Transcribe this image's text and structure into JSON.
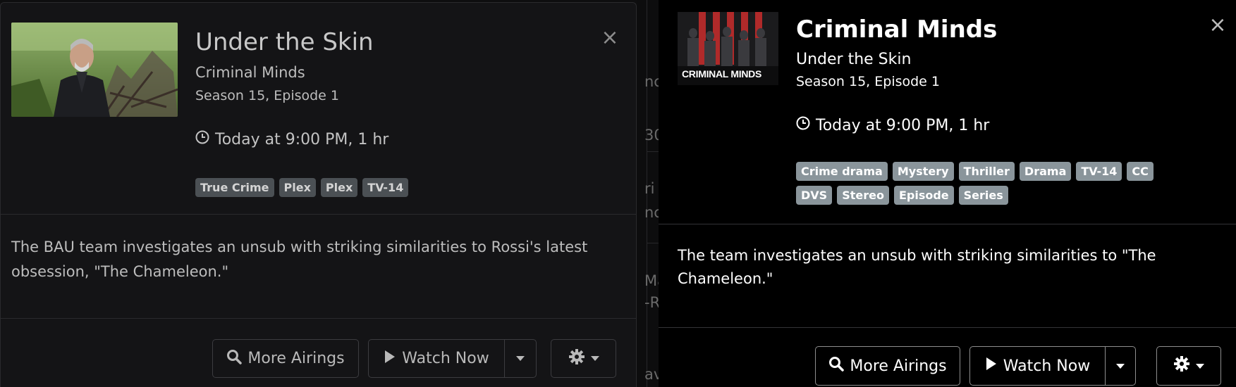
{
  "left_modal": {
    "title": "Under the Skin",
    "show": "Criminal Minds",
    "episode": "Season 15, Episode 1",
    "airtime": "Today at 9:00 PM, 1 hr",
    "badges": [
      "True Crime",
      "Plex",
      "Plex",
      "TV-14"
    ],
    "description": "The BAU team investigates an unsub with striking similarities to Rossi's latest obsession, \"The Chameleon.\"",
    "close_symbol": "×",
    "more_airings_label": "More Airings",
    "watch_now_label": "Watch Now"
  },
  "right_modal": {
    "title": "Criminal Minds",
    "episode_title": "Under the Skin",
    "episode": "Season 15, Episode 1",
    "airtime": "Today at 9:00 PM, 1 hr",
    "badges": [
      "Crime drama",
      "Mystery",
      "Thriller",
      "Drama",
      "TV-14",
      "CC",
      "DVS",
      "Stereo",
      "Episode",
      "Series"
    ],
    "description": "The team investigates an unsub with striking similarities to \"The Chameleon.\"",
    "close_symbol": "×",
    "more_airings_label": "More Airings",
    "watch_now_label": "Watch Now",
    "poster_text": "CRIMINAL MINDS"
  },
  "background_fragments": [
    "nc",
    "30",
    "ri",
    "nc",
    "Ma",
    "-R",
    "av"
  ],
  "icons": {
    "clock": "clock-icon",
    "search": "search-icon",
    "play": "play-icon",
    "gear": "gear-icon",
    "caret": "chevron-down-icon"
  },
  "colors": {
    "left_badge_bg": "#4b5054",
    "right_badge_bg": "#8a959b",
    "left_modal_bg": "#141416",
    "right_modal_bg": "#000000"
  }
}
